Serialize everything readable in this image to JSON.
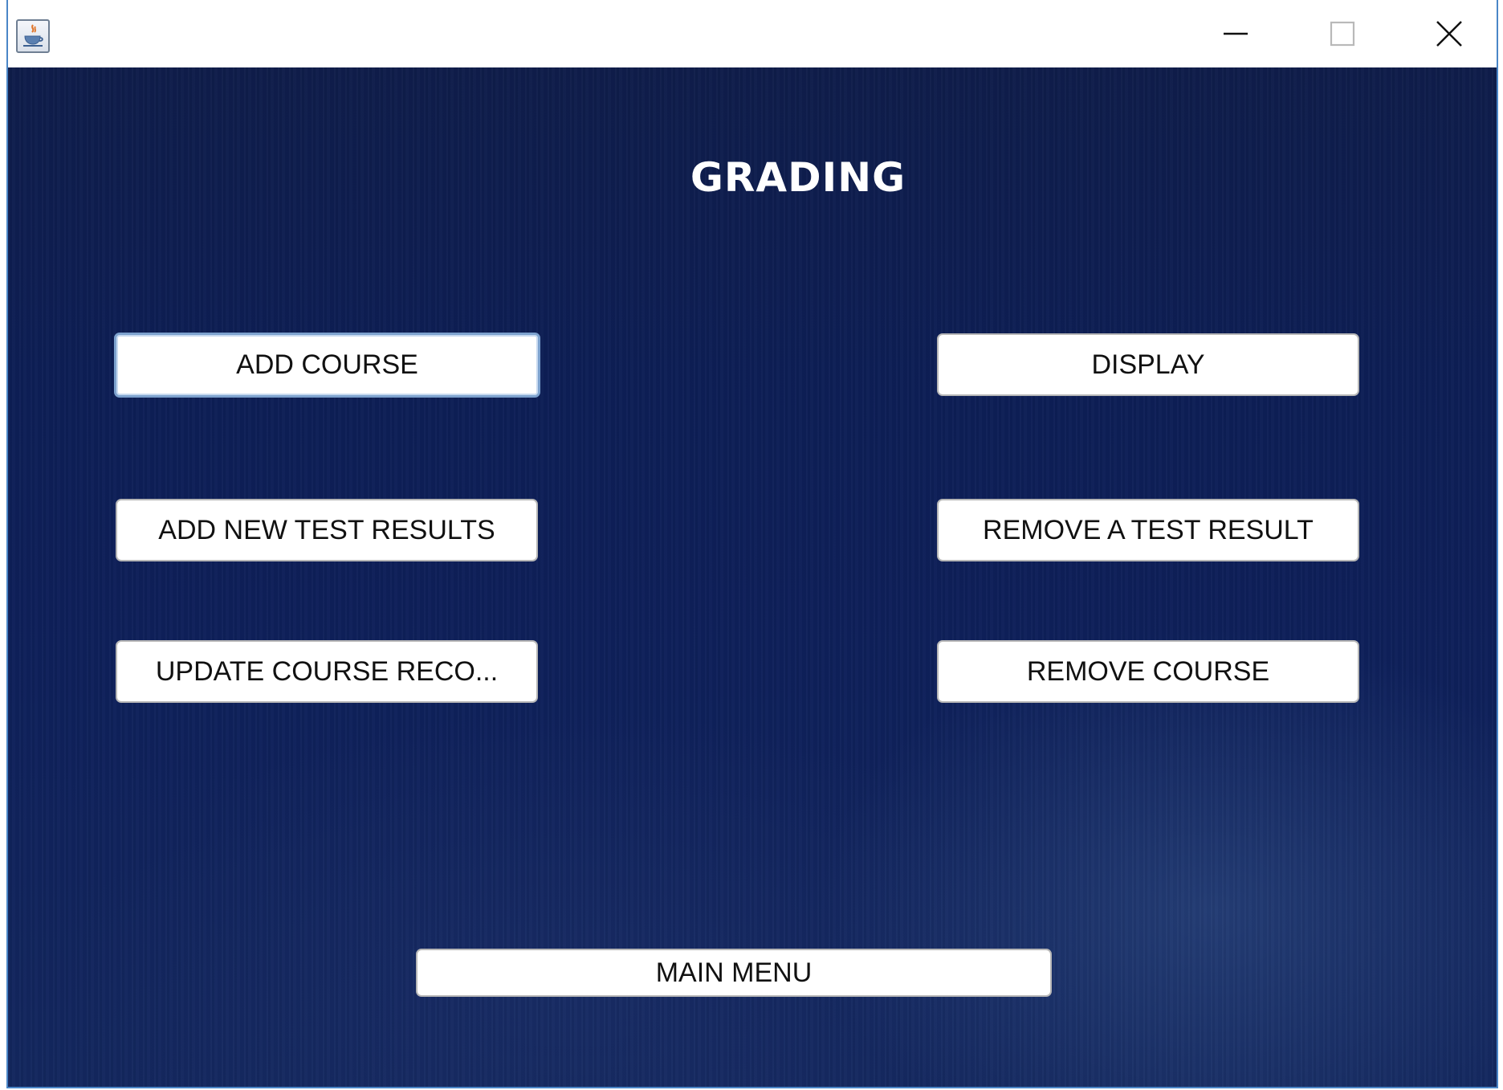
{
  "window": {
    "icon": "java-cup-icon",
    "controls": {
      "minimize": "minimize-icon",
      "maximize": "maximize-icon",
      "close": "close-icon"
    }
  },
  "page": {
    "title": "GRADING"
  },
  "buttons": {
    "add_course": "ADD COURSE",
    "display": "DISPLAY",
    "add_new_test_results": "ADD NEW TEST RESULTS",
    "remove_a_test_result": "REMOVE A TEST RESULT",
    "update_course_record": "UPDATE COURSE RECO...",
    "remove_course": "REMOVE COURSE",
    "main_menu": "MAIN MENU"
  },
  "colors": {
    "background": "#0e205a",
    "button": "#ffffff",
    "button_text": "#111111",
    "title_text": "#ffffff",
    "window_border": "#4a86c7"
  }
}
